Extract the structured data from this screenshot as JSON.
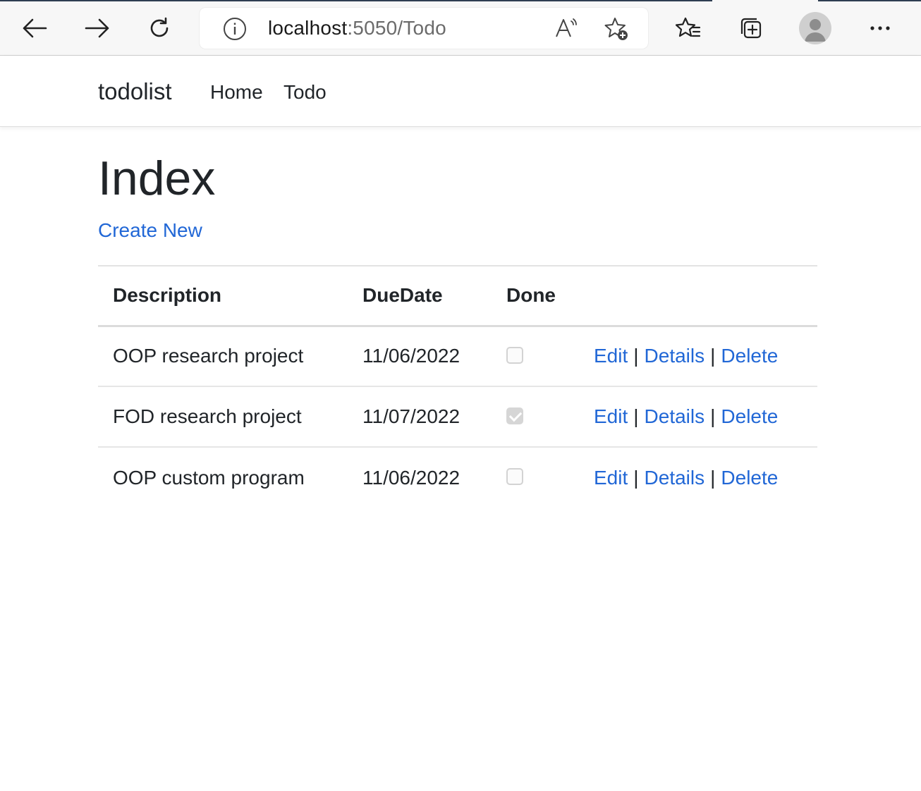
{
  "browser": {
    "url_host": "localhost",
    "url_rest": ":5050/Todo"
  },
  "navbar": {
    "brand": "todolist",
    "links": [
      {
        "label": "Home"
      },
      {
        "label": "Todo"
      }
    ]
  },
  "main": {
    "title": "Index",
    "create_link": "Create New",
    "table": {
      "headers": {
        "description": "Description",
        "due_date": "DueDate",
        "done": "Done"
      },
      "rows": [
        {
          "description": "OOP research project",
          "due_date": "11/06/2022",
          "done": false
        },
        {
          "description": "FOD research project",
          "due_date": "11/07/2022",
          "done": true
        },
        {
          "description": "OOP custom program",
          "due_date": "11/06/2022",
          "done": false
        }
      ],
      "actions": {
        "edit": "Edit",
        "details": "Details",
        "delete": "Delete",
        "separator": "|"
      }
    }
  },
  "colors": {
    "link": "#2167d6",
    "text": "#212529"
  },
  "icons": [
    "back-arrow-icon",
    "forward-arrow-icon",
    "refresh-icon",
    "info-icon",
    "read-aloud-icon",
    "add-favorite-icon",
    "favorites-icon",
    "collections-icon",
    "profile-avatar-icon",
    "more-options-icon"
  ]
}
